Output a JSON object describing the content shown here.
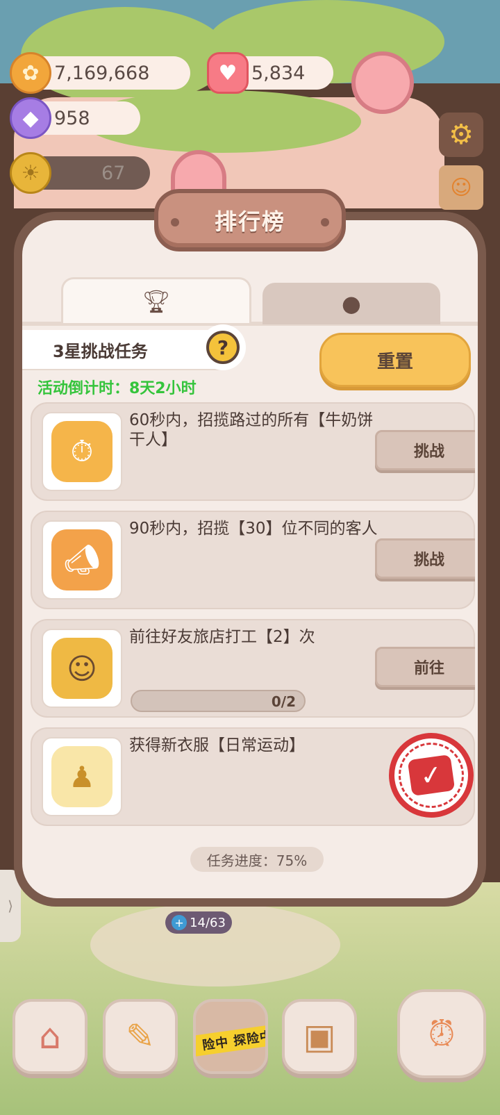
{
  "currencies": {
    "coins": "7,169,668",
    "candy": "5,834",
    "gems": "958",
    "level_progress": "67"
  },
  "dialog": {
    "title": "排行榜",
    "tabs": [
      {
        "icon": "trophy-icon",
        "active": true
      },
      {
        "icon": "cookie-icon",
        "active": false
      }
    ],
    "section_label": "3星挑战任务",
    "help_symbol": "?",
    "countdown": "活动倒计时：8天2小时",
    "reset_label": "重置",
    "tasks": [
      {
        "desc": "60秒内，招揽路过的所有【牛奶饼干人】",
        "action": "挑战",
        "icon": "stopwatch-cookie-icon"
      },
      {
        "desc": "90秒内，招揽【30】位不同的客人",
        "action": "挑战",
        "icon": "megaphone-cookie-icon"
      },
      {
        "desc": "前往好友旅店打工【2】次",
        "action": "前往",
        "progress_text": "0/2",
        "progress": 0.0,
        "icon": "worker-girl-icon"
      },
      {
        "desc": "获得新衣服【日常运动】",
        "completed": true,
        "icon": "outfit-figure-icon"
      }
    ],
    "overall_progress": "任务进度：75%"
  },
  "bottom": {
    "hp": "14/63",
    "dock_banner": "险中 探险中"
  },
  "colors": {
    "accent_yellow": "#f8c35a",
    "countdown_green": "#35c43c",
    "stamp_red": "#d8373b",
    "frame_brown": "#7a5a4c"
  }
}
